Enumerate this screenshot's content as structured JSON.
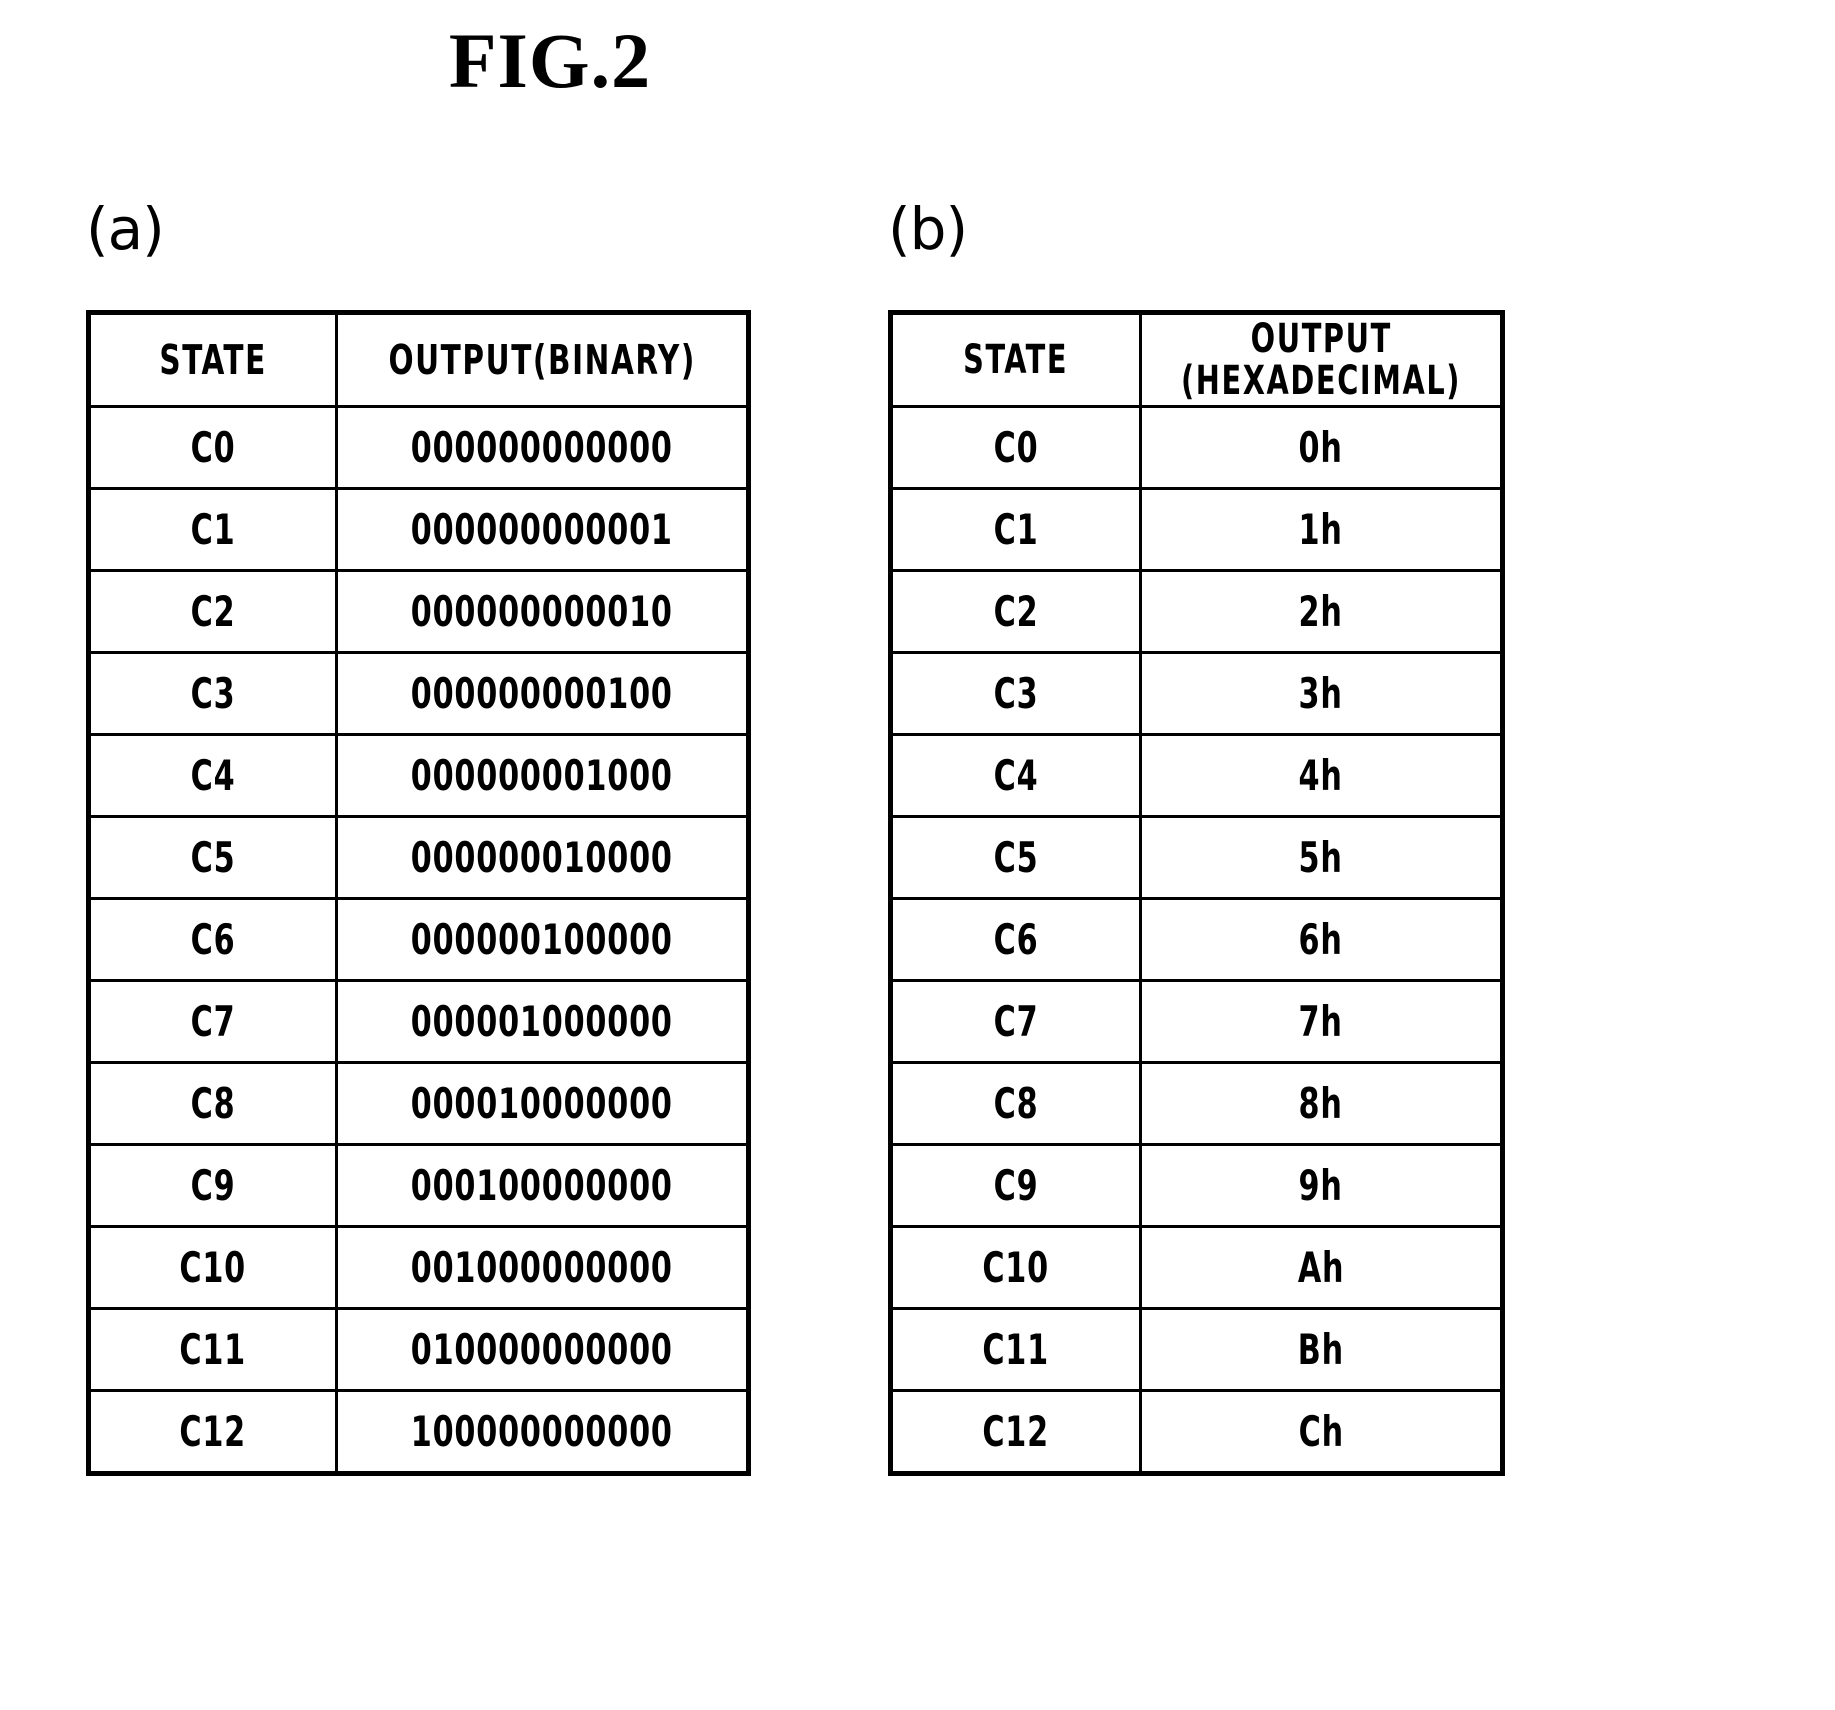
{
  "figure": {
    "title": "FIG.2"
  },
  "panels": [
    {
      "label": "(a)",
      "table": {
        "headers": [
          "STATE",
          "OUTPUT(BINARY)"
        ],
        "rows": [
          {
            "state": "C0",
            "output": "000000000000"
          },
          {
            "state": "C1",
            "output": "000000000001"
          },
          {
            "state": "C2",
            "output": "000000000010"
          },
          {
            "state": "C3",
            "output": "000000000100"
          },
          {
            "state": "C4",
            "output": "000000001000"
          },
          {
            "state": "C5",
            "output": "000000010000"
          },
          {
            "state": "C6",
            "output": "000000100000"
          },
          {
            "state": "C7",
            "output": "000001000000"
          },
          {
            "state": "C8",
            "output": "000010000000"
          },
          {
            "state": "C9",
            "output": "000100000000"
          },
          {
            "state": "C10",
            "output": "001000000000"
          },
          {
            "state": "C11",
            "output": "010000000000"
          },
          {
            "state": "C12",
            "output": "100000000000"
          }
        ]
      }
    },
    {
      "label": "(b)",
      "table": {
        "headers": [
          "STATE",
          "OUTPUT\n(HEXADECIMAL)"
        ],
        "header_output_line1": "OUTPUT",
        "header_output_line2": "(HEXADECIMAL)",
        "rows": [
          {
            "state": "C0",
            "output": "0h"
          },
          {
            "state": "C1",
            "output": "1h"
          },
          {
            "state": "C2",
            "output": "2h"
          },
          {
            "state": "C3",
            "output": "3h"
          },
          {
            "state": "C4",
            "output": "4h"
          },
          {
            "state": "C5",
            "output": "5h"
          },
          {
            "state": "C6",
            "output": "6h"
          },
          {
            "state": "C7",
            "output": "7h"
          },
          {
            "state": "C8",
            "output": "8h"
          },
          {
            "state": "C9",
            "output": "9h"
          },
          {
            "state": "C10",
            "output": "Ah"
          },
          {
            "state": "C11",
            "output": "Bh"
          },
          {
            "state": "C12",
            "output": "Ch"
          }
        ]
      }
    }
  ],
  "colors": {
    "ink": "#000000",
    "paper": "#ffffff"
  }
}
